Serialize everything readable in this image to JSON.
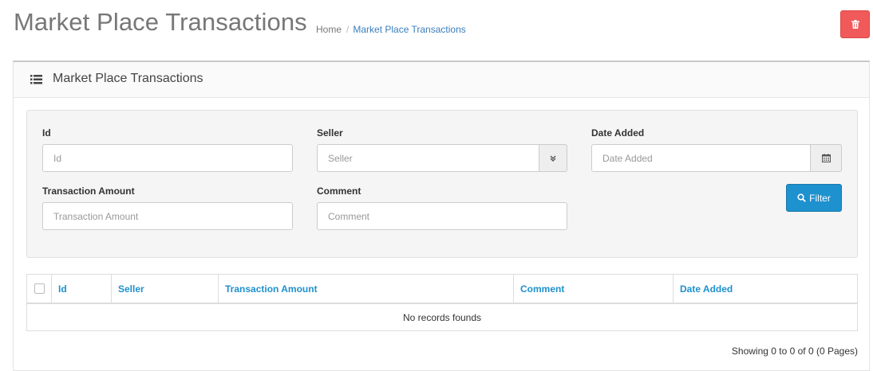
{
  "header": {
    "title": "Market Place Transactions",
    "breadcrumb": [
      {
        "label": "Home"
      },
      {
        "label": "Market Place Transactions"
      }
    ],
    "breadcrumb_separator": "/"
  },
  "panel": {
    "title": "Market Place Transactions",
    "icon": "list-icon"
  },
  "filter": {
    "fields": {
      "id": {
        "label": "Id",
        "placeholder": "Id",
        "value": ""
      },
      "seller": {
        "label": "Seller",
        "placeholder": "Seller",
        "value": ""
      },
      "date_added": {
        "label": "Date Added",
        "placeholder": "Date Added",
        "value": ""
      },
      "transaction_amount": {
        "label": "Transaction Amount",
        "placeholder": "Transaction Amount",
        "value": ""
      },
      "comment": {
        "label": "Comment",
        "placeholder": "Comment",
        "value": ""
      }
    },
    "filter_button_label": "Filter"
  },
  "table": {
    "columns": [
      "Id",
      "Seller",
      "Transaction Amount",
      "Comment",
      "Date Added"
    ],
    "rows": [],
    "empty_message": "No records founds"
  },
  "pagination": {
    "info": "Showing 0 to 0 of 0 (0 Pages)"
  },
  "colors": {
    "delete_button": "#f05a5a",
    "primary": "#1e91cf",
    "link": "#3a7ebc",
    "title": "#777777"
  }
}
